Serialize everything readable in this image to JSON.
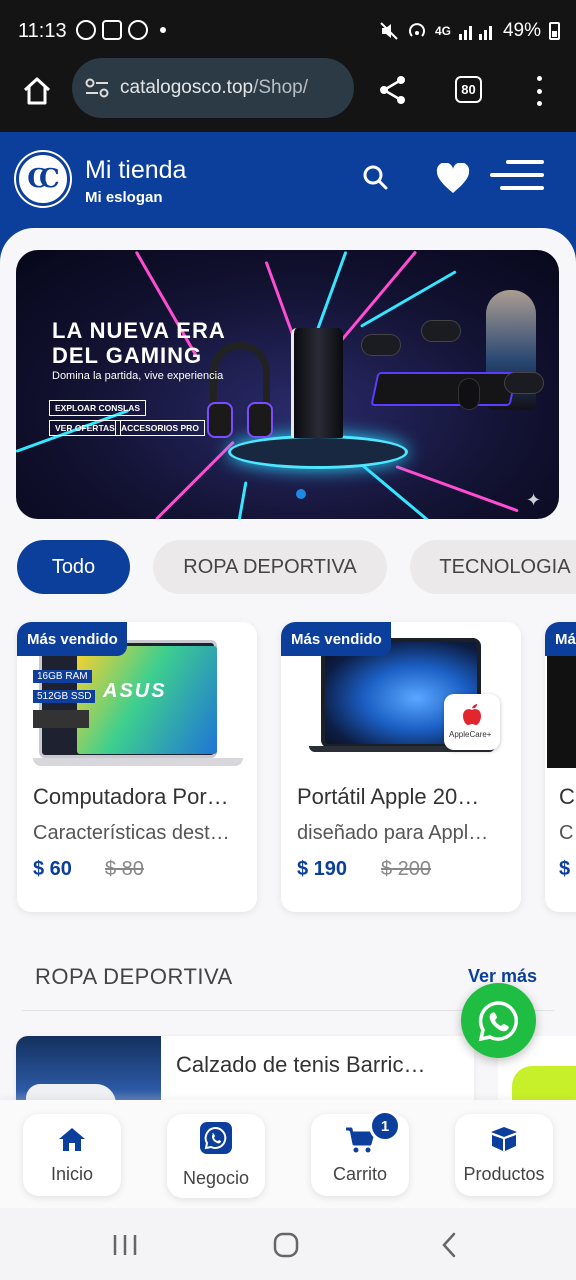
{
  "status_bar": {
    "time": "11:13",
    "network": "4G",
    "battery": "49%"
  },
  "browser": {
    "url_host": "catalogosco.top",
    "url_path": "/Shop/",
    "tab_count": "80"
  },
  "header": {
    "logo_text": "CC",
    "shop_name": "Mi tienda",
    "slogan": "Mi eslogan"
  },
  "banner": {
    "title_line1": "LA NUEVA ERA",
    "title_line2": "DEL GAMING",
    "subtitle": "Domina la partida, vive experiencia",
    "buttons": [
      "EXPLOAR CONSLAS",
      "VER OFERTAS",
      "ACCESORIOS PRO"
    ],
    "active_slide": 1
  },
  "categories": [
    {
      "label": "Todo",
      "active": true
    },
    {
      "label": "ROPA DEPORTIVA",
      "active": false
    },
    {
      "label": "TECNOLOGIA",
      "active": false
    }
  ],
  "products": [
    {
      "badge": "Más vendido",
      "title": "Computadora Por…",
      "description": "Características dest…",
      "price": "$ 60",
      "old_price": "$ 80",
      "image_specs": [
        "16GB RAM",
        "512GB SSD"
      ],
      "image_brand": "ASUS"
    },
    {
      "badge": "Más vendido",
      "title": "Portátil Apple 20…",
      "description": "diseñado para Appl…",
      "price": "$ 190",
      "old_price": "$ 200",
      "image_brand": "AppleCare+"
    },
    {
      "badge": "Má",
      "title": "C",
      "description": "C",
      "price": "$",
      "old_price": ""
    }
  ],
  "section": {
    "title": "ROPA DEPORTIVA",
    "see_more": "Ver más",
    "items": [
      {
        "title": "Calzado de tenis Barric…"
      }
    ]
  },
  "bottom_nav": [
    {
      "label": "Inicio",
      "icon": "home-icon"
    },
    {
      "label": "Negocio",
      "icon": "whatsapp-icon"
    },
    {
      "label": "Carrito",
      "icon": "cart-icon",
      "badge": "1"
    },
    {
      "label": "Productos",
      "icon": "box-icon"
    }
  ],
  "colors": {
    "primary": "#0c3f9c",
    "whatsapp": "#1fbe42",
    "chip_inactive": "#ece9ea"
  }
}
